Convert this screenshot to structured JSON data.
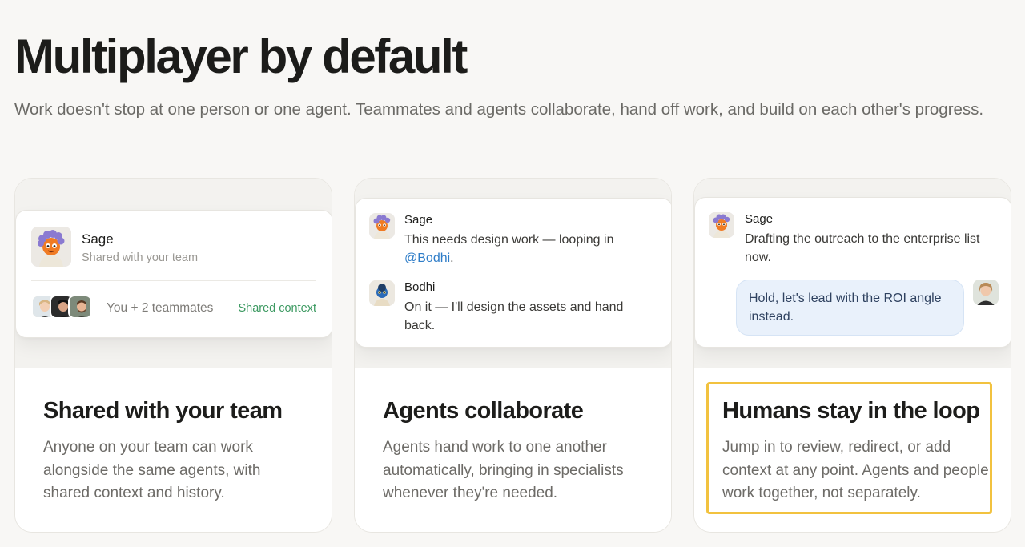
{
  "hero": {
    "title": "Multiplayer by default",
    "subtitle": "Work doesn't stop at one person or one agent. Teammates and agents collaborate, hand off work, and build on each other's progress."
  },
  "cards": [
    {
      "heading": "Shared with your team",
      "description": "Anyone on your team can work alongside the same agents, with shared context and history.",
      "preview": {
        "agent_name": "Sage",
        "agent_subtitle": "Shared with your team",
        "teammates_text": "You + 2 teammates",
        "context_label": "Shared context"
      }
    },
    {
      "heading": "Agents collaborate",
      "description": "Agents hand work to one another automatically, bringing in specialists whenever they're needed.",
      "preview": {
        "msg1_name": "Sage",
        "msg1_text": "This needs design work — looping in",
        "msg1_mention": "@Bodhi",
        "msg1_end": ".",
        "msg2_name": "Bodhi",
        "msg2_text": "On it — I'll design the assets and hand back."
      }
    },
    {
      "heading": "Humans stay in the loop",
      "description": "Jump in to review, redirect, or add context at any point. Agents and people work together, not separately.",
      "preview": {
        "msg1_name": "Sage",
        "msg1_text": "Drafting the outreach to the enterprise list now.",
        "reply_text": "Hold, let's lead with the ROI angle instead."
      }
    }
  ],
  "colors": {
    "accent_green": "#3d9a62",
    "mention_blue": "#2f7dc8",
    "highlight_yellow": "#f2c23f",
    "reply_bubble": "#e9f1fb"
  },
  "icons": [
    "sage-avatar-icon",
    "bodhi-avatar-icon",
    "teammate-avatar-icon"
  ]
}
